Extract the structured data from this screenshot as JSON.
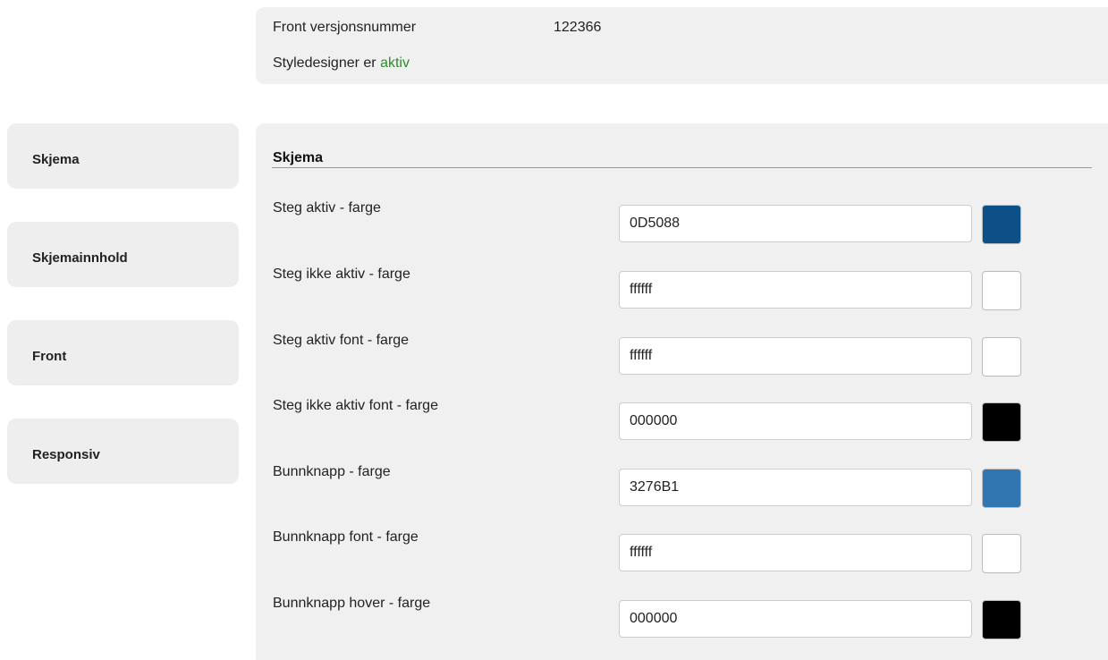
{
  "info": {
    "version_label": "Front versjonsnummer",
    "version_value": "122366",
    "styledesigner_prefix": "Styledesigner er",
    "styledesigner_status": "aktiv",
    "status_color": "#2e8b2e"
  },
  "sidebar": {
    "items": [
      {
        "label": "Skjema"
      },
      {
        "label": "Skjemainnhold"
      },
      {
        "label": "Front"
      },
      {
        "label": "Responsiv"
      }
    ]
  },
  "main": {
    "section_title": "Skjema",
    "fields": [
      {
        "label": "Steg aktiv - farge",
        "value": "0D5088",
        "swatch": "#0D5088"
      },
      {
        "label": "Steg ikke aktiv - farge",
        "value": "ffffff",
        "swatch": "#ffffff"
      },
      {
        "label": "Steg aktiv font - farge",
        "value": "ffffff",
        "swatch": "#ffffff"
      },
      {
        "label": "Steg ikke aktiv font - farge",
        "value": "000000",
        "swatch": "#000000"
      },
      {
        "label": "Bunnknapp - farge",
        "value": "3276B1",
        "swatch": "#3276B1"
      },
      {
        "label": "Bunnknapp font - farge",
        "value": "ffffff",
        "swatch": "#ffffff"
      },
      {
        "label": "Bunnknapp hover - farge",
        "value": "000000",
        "swatch": "#000000"
      }
    ]
  }
}
